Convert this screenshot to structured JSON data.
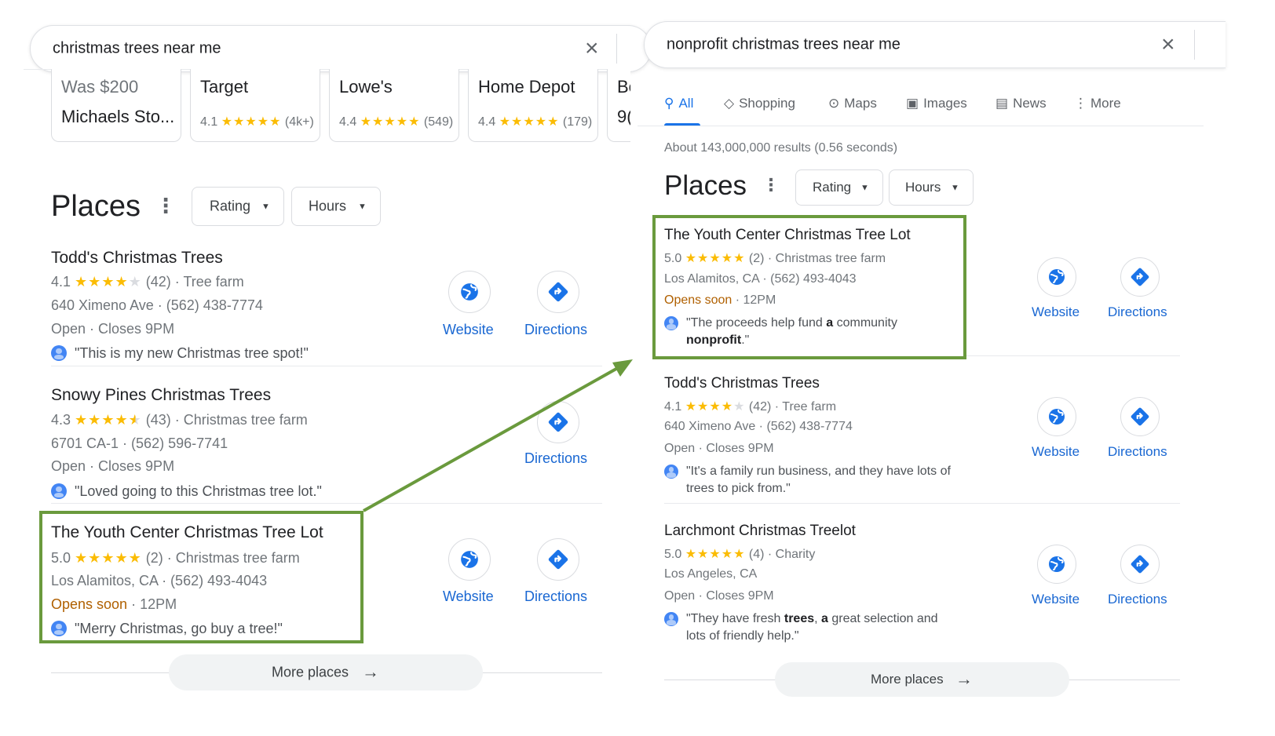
{
  "left": {
    "search": {
      "query": "christmas trees near me"
    },
    "shopping_cards": [
      {
        "line1": "Was $200",
        "line2": "Michaels Sto...",
        "rating": "",
        "stars": "",
        "count": ""
      },
      {
        "line1": "Target",
        "rating": "4.1",
        "stars": "★★★★★",
        "count": "(4k+)"
      },
      {
        "line1": "Lowe's",
        "rating": "4.4",
        "stars": "★★★★★",
        "count": "(549)"
      },
      {
        "line1": "Home Depot",
        "rating": "4.4",
        "stars": "★★★★★",
        "count": "(179)"
      },
      {
        "line1": "Be",
        "line2": "9("
      }
    ],
    "places_title": "Places",
    "chips": [
      "Rating",
      "Hours"
    ],
    "places": [
      {
        "name": "Todd's Christmas Trees",
        "rating": "4.1",
        "stars_on": "★★★★",
        "stars_off": "★",
        "count": "(42)",
        "category": "· Tree farm",
        "address": "640 Ximeno Ave · (562) 438-7774",
        "status": "",
        "hours": "Open · Closes 9PM",
        "review": "\"This is my new Christmas tree spot!\"",
        "website": "Website",
        "directions": "Directions"
      },
      {
        "name": "Snowy Pines Christmas Trees",
        "rating": "4.3",
        "stars_on": "★★★★",
        "stars_half": "★",
        "count": "(43)",
        "category": "· Christmas tree farm",
        "address": "6701 CA-1 · (562) 596-7741",
        "status": "",
        "hours": "Open · Closes 9PM",
        "review": "\"Loved going to this Christmas tree lot.\"",
        "directions": "Directions"
      },
      {
        "name": "The Youth Center Christmas Tree Lot",
        "rating": "5.0",
        "stars_on": "★★★★★",
        "count": "(2)",
        "category": "· Christmas tree farm",
        "address": "Los Alamitos, CA · (562) 493-4043",
        "status": "Opens soon",
        "hours": "· 12PM",
        "review": "\"Merry Christmas, go buy a tree!\"",
        "website": "Website",
        "directions": "Directions"
      }
    ],
    "more_places": "More places"
  },
  "right": {
    "search": {
      "query": "nonprofit christmas trees near me"
    },
    "tabs": [
      {
        "label": "All",
        "icon": "search-icon"
      },
      {
        "label": "Shopping",
        "icon": "tag-icon"
      },
      {
        "label": "Maps",
        "icon": "map-pin-icon"
      },
      {
        "label": "Images",
        "icon": "image-icon"
      },
      {
        "label": "News",
        "icon": "news-icon"
      },
      {
        "label": "More",
        "icon": "kebab-icon"
      }
    ],
    "stats": "About 143,000,000 results (0.56 seconds)",
    "places_title": "Places",
    "chips": [
      "Rating",
      "Hours"
    ],
    "places": [
      {
        "name": "The Youth Center Christmas Tree Lot",
        "rating": "5.0",
        "stars_on": "★★★★★",
        "count": "(2)",
        "category": "· Christmas tree farm",
        "address": "Los Alamitos, CA · (562) 493-4043",
        "status": "Opens soon",
        "hours": "· 12PM",
        "review_pre": "\"The proceeds help fund ",
        "review_b1": "a",
        "review_mid": " community",
        "review_b2": "nonprofit",
        "review_post": ".\"",
        "website": "Website",
        "directions": "Directions"
      },
      {
        "name": "Todd's Christmas Trees",
        "rating": "4.1",
        "stars_on": "★★★★",
        "stars_off": "★",
        "count": "(42)",
        "category": "· Tree farm",
        "address": "640 Ximeno Ave · (562) 438-7774",
        "hours": "Open · Closes 9PM",
        "review_l1": "\"It's a family run business, and they have lots of",
        "review_l2": "trees to pick from.\"",
        "website": "Website",
        "directions": "Directions"
      },
      {
        "name": "Larchmont Christmas Treelot",
        "rating": "5.0",
        "stars_on": "★★★★★",
        "count": "(4)",
        "category": "· Charity",
        "address": "Los Angeles, CA",
        "hours": "Open · Closes 9PM",
        "review_pre": "\"They have fresh ",
        "review_b1": "trees",
        "review_mid": ", ",
        "review_b2": "a",
        "review_post": " great selection and",
        "review_l2": "lots of friendly help.\"",
        "website": "Website",
        "directions": "Directions"
      }
    ],
    "more_places": "More places"
  },
  "colors": {
    "link": "#1967d2",
    "star": "#fbbc04",
    "highlight": "#6a9a3d",
    "opens_soon": "#b06000",
    "tab_active": "#1a73e8"
  }
}
